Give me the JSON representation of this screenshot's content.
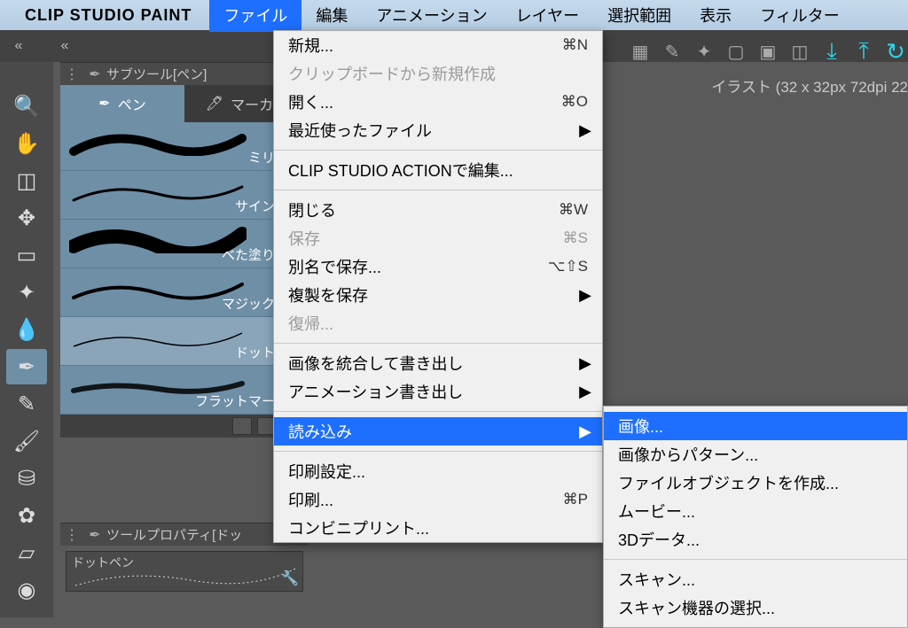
{
  "menubar": {
    "app_title": "CLIP STUDIO PAINT",
    "items": [
      "ファイル",
      "編集",
      "アニメーション",
      "レイヤー",
      "選択範囲",
      "表示",
      "フィルター"
    ],
    "open_index": 0
  },
  "canvas_info": "イラスト (32 x 32px 72dpi 22",
  "subtool_header": "サブツール[ペン]",
  "tabs": [
    {
      "label": "ペン",
      "active": true
    },
    {
      "label": "マーカー",
      "active": false
    }
  ],
  "brushes": [
    {
      "name": "ミリペン"
    },
    {
      "name": "サインペン"
    },
    {
      "name": "べた塗りペン"
    },
    {
      "name": "マジックペン"
    },
    {
      "name": "ドットペン",
      "sel": true
    },
    {
      "name": "フラットマーカー"
    }
  ],
  "toolprop_header": "ツールプロパティ[ドッ",
  "toolprop_name": "ドットペン",
  "file_menu": [
    {
      "label": "新規...",
      "shortcut": "⌘N"
    },
    {
      "label": "クリップボードから新規作成",
      "disabled": true
    },
    {
      "label": "開く...",
      "shortcut": "⌘O"
    },
    {
      "label": "最近使ったファイル",
      "arrow": true
    },
    {
      "sep": true
    },
    {
      "label": "CLIP STUDIO ACTIONで編集..."
    },
    {
      "sep": true
    },
    {
      "label": "閉じる",
      "shortcut": "⌘W"
    },
    {
      "label": "保存",
      "shortcut": "⌘S",
      "disabled": true
    },
    {
      "label": "別名で保存...",
      "shortcut": "⌥⇧S"
    },
    {
      "label": "複製を保存",
      "arrow": true
    },
    {
      "label": "復帰...",
      "disabled": true
    },
    {
      "sep": true
    },
    {
      "label": "画像を統合して書き出し",
      "arrow": true
    },
    {
      "label": "アニメーション書き出し",
      "arrow": true
    },
    {
      "sep": true
    },
    {
      "label": "読み込み",
      "arrow": true,
      "hl": true
    },
    {
      "sep": true
    },
    {
      "label": "印刷設定..."
    },
    {
      "label": "印刷...",
      "shortcut": "⌘P"
    },
    {
      "label": "コンビニプリント..."
    }
  ],
  "import_submenu": [
    {
      "label": "画像...",
      "hl": true
    },
    {
      "label": "画像からパターン..."
    },
    {
      "label": "ファイルオブジェクトを作成..."
    },
    {
      "label": "ムービー..."
    },
    {
      "label": "3Dデータ..."
    },
    {
      "sep": true
    },
    {
      "label": "スキャン..."
    },
    {
      "label": "スキャン機器の選択..."
    }
  ]
}
